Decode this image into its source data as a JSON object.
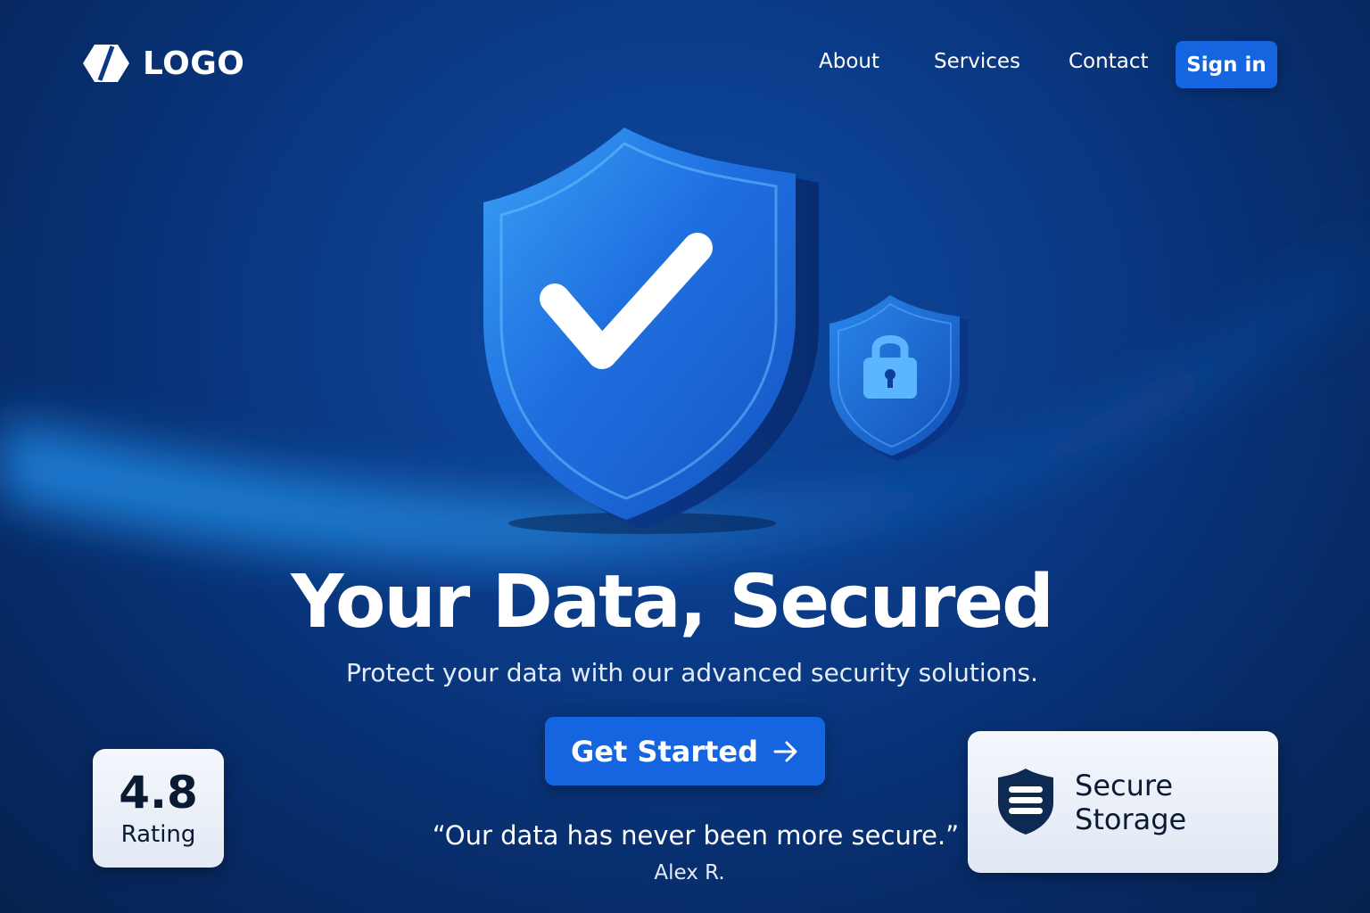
{
  "navbar": {
    "logo_text": "LOGO",
    "links": [
      "About",
      "Services",
      "Contact"
    ],
    "signin_label": "Sign in"
  },
  "hero": {
    "headline": "Your Data, Secured",
    "subheadline": "Protect your data with our advanced security solutions.",
    "cta_label": "Get Started"
  },
  "testimonial": {
    "quote": "“Our data has never been more secure.”",
    "author": "Alex R."
  },
  "rating_card": {
    "value": "4.8",
    "label": "Rating"
  },
  "storage_card": {
    "label": "Secure Storage"
  },
  "icons": [
    "logo-icon",
    "shield-check-icon",
    "shield-lock-icon",
    "arrow-right-icon",
    "storage-shield-icon"
  ],
  "colors": {
    "background": "#0a3a86",
    "accent": "#1565e0",
    "card_text": "#0b1a33",
    "card_bg": "#eef2f9"
  }
}
